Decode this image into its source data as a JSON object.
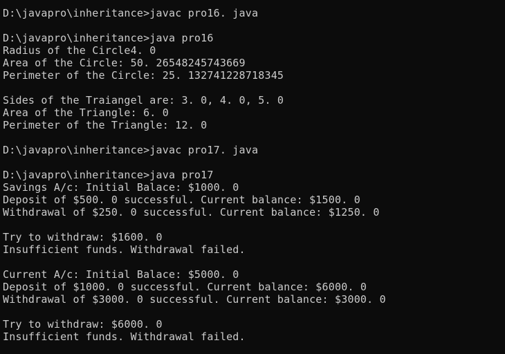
{
  "window": {
    "background": "#0c0c0c",
    "text_color": "#cccccc"
  },
  "lines": [
    "D:\\javapro\\inheritance>javac pro16. java",
    "",
    "D:\\javapro\\inheritance>java pro16",
    "Radius of the Circle4. 0",
    "Area of the Circle: 50. 26548245743669",
    "Perimeter of the Circle: 25. 132741228718345",
    "",
    "Sides of the Traiangel are: 3. 0, 4. 0, 5. 0",
    "Area of the Triangle: 6. 0",
    "Perimeter of the Triangle: 12. 0",
    "",
    "D:\\javapro\\inheritance>javac pro17. java",
    "",
    "D:\\javapro\\inheritance>java pro17",
    "Savings A/c: Initial Balace: $1000. 0",
    "Deposit of $500. 0 successful. Current balance: $1500. 0",
    "Withdrawal of $250. 0 successful. Current balance: $1250. 0",
    "",
    "Try to withdraw: $1600. 0",
    "Insufficient funds. Withdrawal failed.",
    "",
    "Current A/c: Initial Balace: $5000. 0",
    "Deposit of $1000. 0 successful. Current balance: $6000. 0",
    "Withdrawal of $3000. 0 successful. Current balance: $3000. 0",
    "",
    "Try to withdraw: $6000. 0",
    "Insufficient funds. Withdrawal failed."
  ]
}
